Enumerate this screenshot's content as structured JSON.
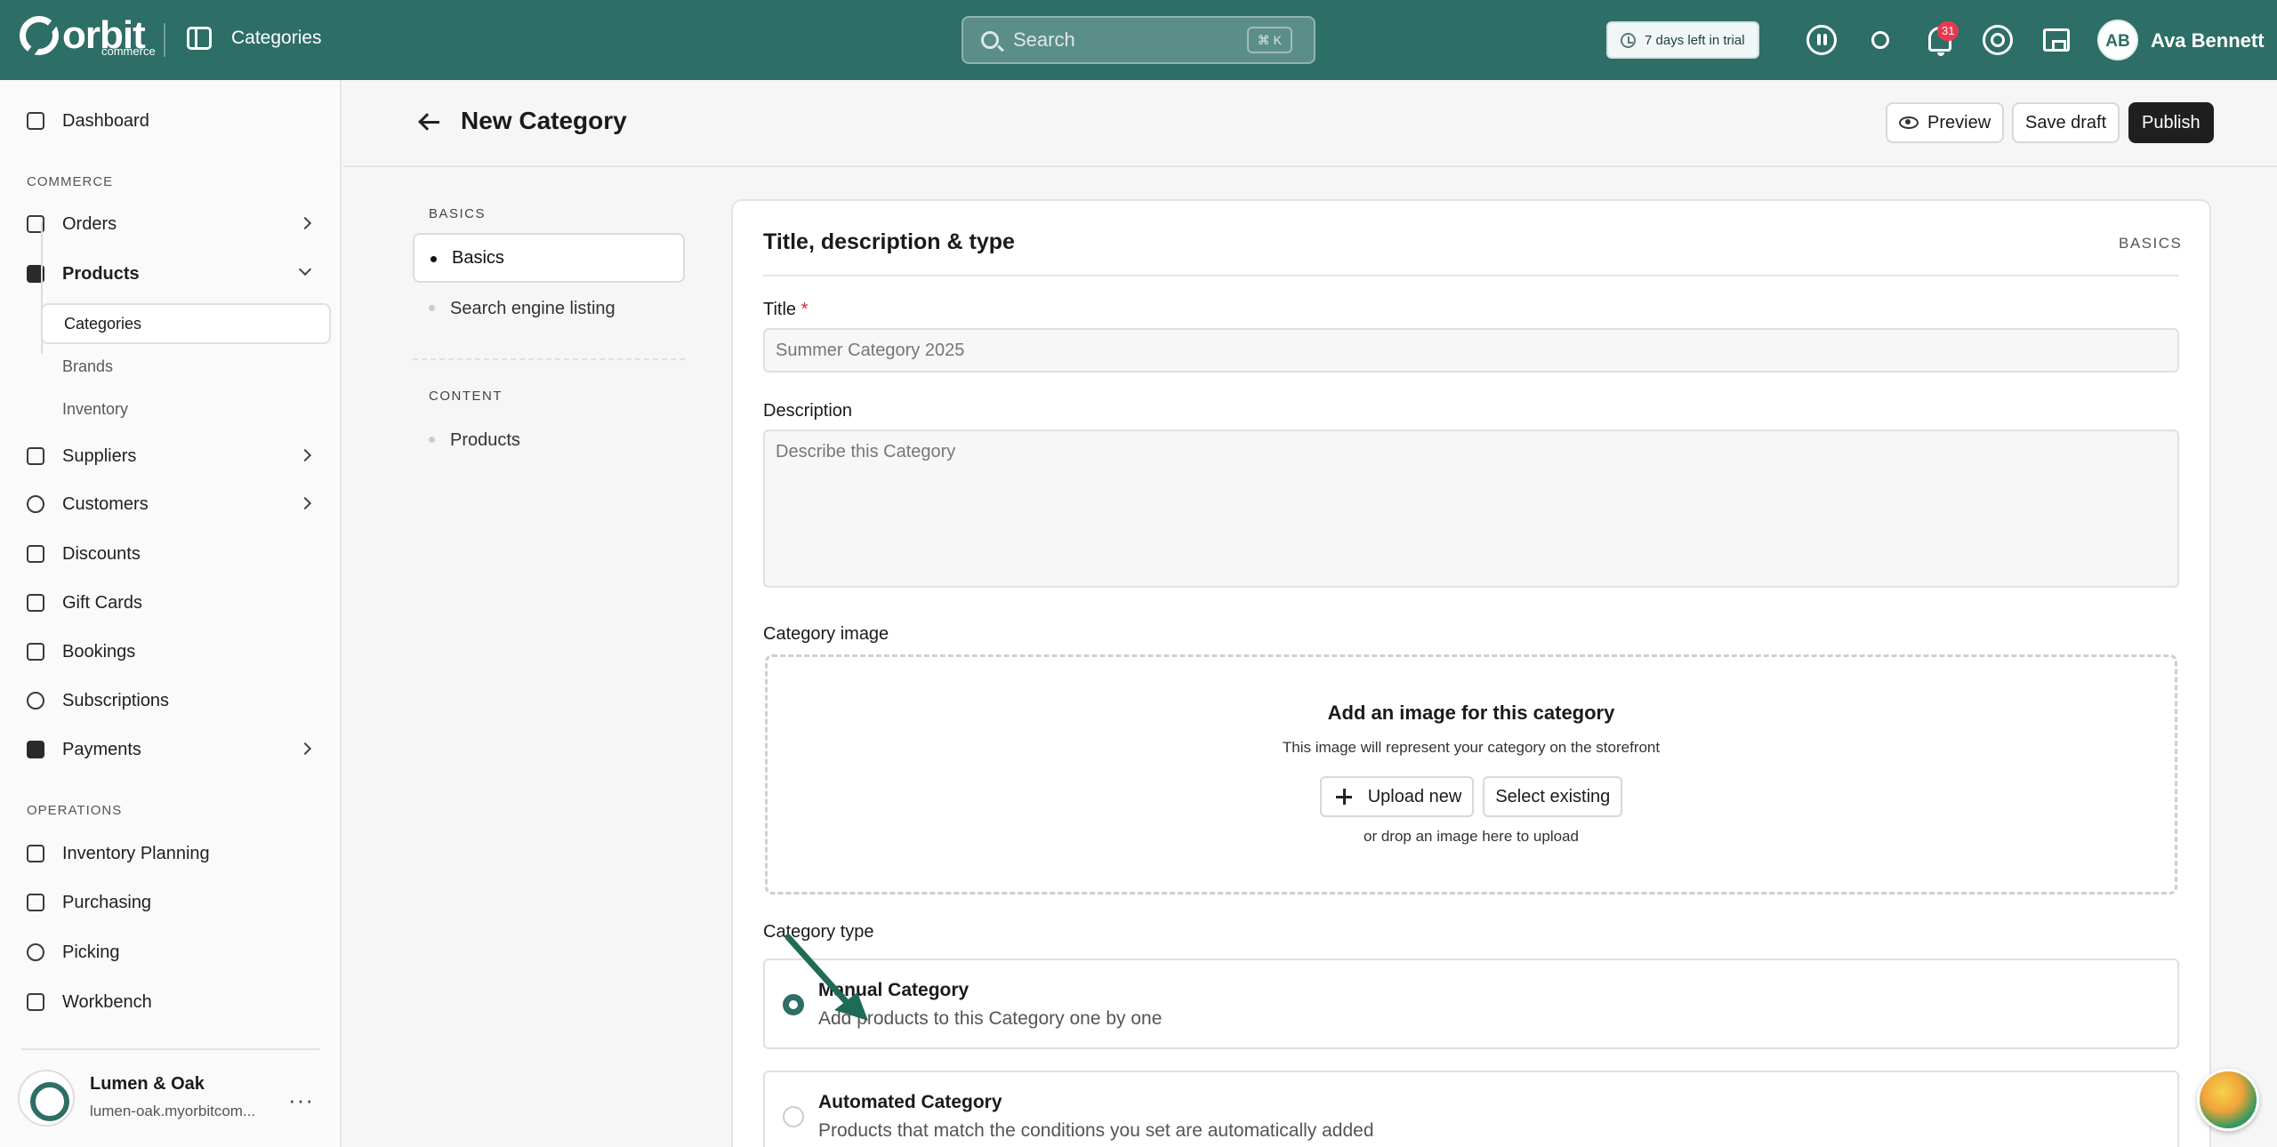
{
  "topbar": {
    "logo_text": "orbit",
    "logo_sub": "commerce",
    "section_title": "Categories",
    "search_placeholder": "Search",
    "search_shortcut": "⌘ K",
    "trial_text": "7 days left in trial",
    "notifications_count": "31",
    "user_initials": "AB",
    "user_name": "Ava Bennett",
    "brand_color": "#2d6e66"
  },
  "sidebar": {
    "dashboard": "Dashboard",
    "commerce_label": "COMMERCE",
    "orders": "Orders",
    "products": "Products",
    "products_sub": [
      "Categories",
      "Brands",
      "Inventory"
    ],
    "suppliers": "Suppliers",
    "customers": "Customers",
    "discounts": "Discounts",
    "gift_cards": "Gift Cards",
    "bookings": "Bookings",
    "subscriptions": "Subscriptions",
    "payments": "Payments",
    "operations_label": "OPERATIONS",
    "inventory_planning": "Inventory Planning",
    "purchasing": "Purchasing",
    "picking": "Picking",
    "workbench": "Workbench",
    "store_name": "Lumen & Oak",
    "store_url": "lumen-oak.myorbitcom..."
  },
  "header": {
    "title": "New Category",
    "preview": "Preview",
    "save_draft": "Save draft",
    "publish": "Publish"
  },
  "inner_nav": {
    "basics_label": "BASICS",
    "basics": "Basics",
    "seo": "Search engine listing",
    "content_label": "CONTENT",
    "products": "Products"
  },
  "form": {
    "card_title": "Title, description & type",
    "card_tag": "BASICS",
    "title_label": "Title",
    "title_required": "*",
    "title_placeholder": "Summer Category 2025",
    "description_label": "Description",
    "description_placeholder": "Describe this Category",
    "image_label": "Category image",
    "image_title": "Add an image for this category",
    "image_sub": "This image will represent your category on the storefront",
    "upload_new": "Upload new",
    "select_existing": "Select existing",
    "drop_hint": "or drop an image here to upload",
    "type_label": "Category type",
    "manual_title": "Manual Category",
    "manual_desc": "Add products to this Category one by one",
    "automated_title": "Automated Category",
    "automated_desc": "Products that match the conditions you set are automatically added"
  }
}
